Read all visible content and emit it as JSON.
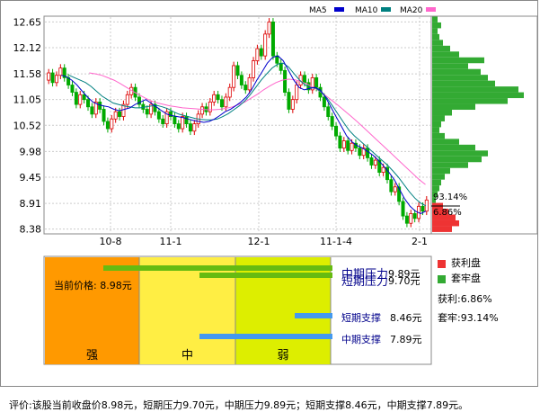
{
  "legend": {
    "ma5": {
      "label": "MA5",
      "color": "#0000cc"
    },
    "ma10": {
      "label": "MA10",
      "color": "#008080"
    },
    "ma20": {
      "label": "MA20",
      "color": "#ff66cc"
    }
  },
  "chips": {
    "profit_pct_label": "93.14%",
    "loss_pct_label": "6.86%"
  },
  "bands": {
    "strong": "强",
    "mid": "中",
    "weak": "弱"
  },
  "current_price_label": "当前价格: 8.98元",
  "levels": [
    {
      "name": "中期压力",
      "value": "9.89元",
      "price": 9.89
    },
    {
      "name": "短期压力",
      "value": "9.70元",
      "price": 9.7
    },
    {
      "name": "短期支撑",
      "value": "8.46元",
      "price": 8.46
    },
    {
      "name": "中期支撑",
      "value": "7.89元",
      "price": 7.89
    }
  ],
  "side_legend": {
    "profit": "获利盘",
    "trapped": "套牢盘",
    "profit_ratio": "获利:6.86%",
    "trapped_ratio": "套牢:93.14%",
    "profit_color": "#ee3333",
    "trapped_color": "#33aa33"
  },
  "footer": "评价:该股当前收盘价8.98元，短期压力9.70元，中期压力9.89元；短期支撑8.46元，中期支撑7.89元。",
  "chart_data": {
    "type": "candlestick",
    "yticks": [
      12.65,
      12.12,
      11.58,
      11.05,
      10.52,
      9.98,
      9.45,
      8.91,
      8.38
    ],
    "ylim": [
      8.3,
      12.75
    ],
    "xticks": [
      "10-8",
      "11-1",
      "12-1",
      "11-1-4",
      "2-1"
    ],
    "grid": true,
    "candles": [
      [
        11.45,
        11.6
      ],
      [
        11.6,
        11.4
      ],
      [
        11.4,
        11.55
      ],
      [
        11.55,
        11.7
      ],
      [
        11.7,
        11.5
      ],
      [
        11.5,
        11.35
      ],
      [
        11.35,
        11.2
      ],
      [
        11.2,
        10.95
      ],
      [
        10.95,
        11.15
      ],
      [
        11.15,
        11.05
      ],
      [
        11.05,
        10.9
      ],
      [
        10.9,
        10.75
      ],
      [
        10.75,
        11.0
      ],
      [
        11.0,
        10.85
      ],
      [
        10.85,
        10.6
      ],
      [
        10.6,
        10.45
      ],
      [
        10.45,
        10.65
      ],
      [
        10.65,
        10.8
      ],
      [
        10.8,
        10.7
      ],
      [
        10.7,
        10.95
      ],
      [
        10.95,
        11.15
      ],
      [
        11.15,
        11.3
      ],
      [
        11.3,
        11.1
      ],
      [
        11.1,
        10.95
      ],
      [
        10.95,
        10.85
      ],
      [
        10.85,
        10.75
      ],
      [
        10.75,
        10.95
      ],
      [
        10.95,
        10.8
      ],
      [
        10.8,
        10.65
      ],
      [
        10.65,
        10.55
      ],
      [
        10.55,
        10.8
      ],
      [
        10.8,
        10.7
      ],
      [
        10.7,
        10.55
      ],
      [
        10.55,
        10.45
      ],
      [
        10.45,
        10.7
      ],
      [
        10.7,
        10.55
      ],
      [
        10.55,
        10.4
      ],
      [
        10.4,
        10.55
      ],
      [
        10.55,
        10.75
      ],
      [
        10.75,
        10.9
      ],
      [
        10.9,
        10.8
      ],
      [
        10.8,
        11.0
      ],
      [
        11.0,
        11.15
      ],
      [
        11.15,
        11.05
      ],
      [
        11.05,
        10.9
      ],
      [
        10.9,
        11.1
      ],
      [
        11.1,
        11.3
      ],
      [
        11.3,
        11.75
      ],
      [
        11.75,
        11.55
      ],
      [
        11.55,
        11.35
      ],
      [
        11.35,
        11.25
      ],
      [
        11.25,
        11.5
      ],
      [
        11.5,
        11.85
      ],
      [
        11.85,
        12.1
      ],
      [
        12.1,
        11.95
      ],
      [
        11.95,
        12.4
      ],
      [
        12.4,
        12.65
      ],
      [
        12.65,
        11.95
      ],
      [
        11.95,
        11.8
      ],
      [
        11.8,
        11.65
      ],
      [
        11.65,
        11.2
      ],
      [
        11.2,
        10.85
      ],
      [
        10.85,
        11.05
      ],
      [
        11.05,
        11.35
      ],
      [
        11.35,
        11.55
      ],
      [
        11.55,
        11.4
      ],
      [
        11.4,
        11.25
      ],
      [
        11.25,
        11.5
      ],
      [
        11.5,
        11.3
      ],
      [
        11.3,
        11.1
      ],
      [
        11.1,
        10.9
      ],
      [
        10.9,
        10.7
      ],
      [
        10.7,
        10.5
      ],
      [
        10.5,
        10.3
      ],
      [
        10.3,
        10.05
      ],
      [
        10.05,
        10.2
      ],
      [
        10.2,
        10.0
      ],
      [
        10.0,
        10.15
      ],
      [
        10.15,
        10.05
      ],
      [
        10.05,
        9.9
      ],
      [
        9.9,
        10.05
      ],
      [
        10.05,
        9.85
      ],
      [
        9.85,
        9.7
      ],
      [
        9.7,
        9.8
      ],
      [
        9.8,
        9.55
      ],
      [
        9.55,
        9.65
      ],
      [
        9.65,
        9.4
      ],
      [
        9.4,
        9.15
      ],
      [
        9.15,
        9.25
      ],
      [
        9.25,
        8.95
      ],
      [
        8.95,
        8.65
      ],
      [
        8.65,
        8.5
      ],
      [
        8.5,
        8.7
      ],
      [
        8.7,
        8.6
      ],
      [
        8.6,
        8.85
      ],
      [
        8.85,
        8.75
      ],
      [
        8.75,
        8.98
      ]
    ],
    "ma5": [
      11.55,
      11.52,
      11.45,
      11.35,
      11.22,
      11.1,
      11.0,
      10.95,
      10.92,
      10.9,
      10.85,
      10.82,
      10.85,
      10.88,
      10.95,
      11.0,
      11.05,
      10.98,
      10.9,
      10.82,
      10.75,
      10.72,
      10.7,
      10.68,
      10.65,
      10.62,
      10.6,
      10.58,
      10.6,
      10.65,
      10.72,
      10.8,
      10.85,
      10.92,
      11.0,
      11.1,
      11.25,
      11.45,
      11.62,
      11.8,
      11.92,
      11.95,
      11.85,
      11.65,
      11.45,
      11.3,
      11.25,
      11.28,
      11.3,
      11.25,
      11.1,
      10.9,
      10.7,
      10.5,
      10.3,
      10.18,
      10.1,
      10.05,
      9.98,
      9.9,
      9.8,
      9.68,
      9.55,
      9.4,
      9.2,
      9.0,
      8.85,
      8.75,
      8.7,
      8.75
    ],
    "ma10": [
      11.55,
      11.5,
      11.45,
      11.4,
      11.32,
      11.22,
      11.12,
      11.05,
      10.98,
      10.95,
      10.92,
      10.9,
      10.88,
      10.88,
      10.9,
      10.92,
      10.93,
      10.9,
      10.86,
      10.8,
      10.75,
      10.72,
      10.69,
      10.66,
      10.64,
      10.63,
      10.63,
      10.65,
      10.7,
      10.76,
      10.84,
      10.92,
      11.02,
      11.15,
      11.3,
      11.45,
      11.58,
      11.7,
      11.78,
      11.8,
      11.72,
      11.58,
      11.45,
      11.35,
      11.3,
      11.28,
      11.2,
      11.08,
      10.92,
      10.75,
      10.58,
      10.42,
      10.3,
      10.2,
      10.1,
      10.0,
      9.9,
      9.8,
      9.7,
      9.58,
      9.45,
      9.3,
      9.15,
      9.02,
      8.92,
      8.86
    ],
    "ma20": [
      11.6,
      11.58,
      11.55,
      11.5,
      11.45,
      11.38,
      11.3,
      11.22,
      11.15,
      11.08,
      11.02,
      10.98,
      10.95,
      10.92,
      10.9,
      10.88,
      10.87,
      10.86,
      10.85,
      10.84,
      10.84,
      10.85,
      10.87,
      10.9,
      10.95,
      11.0,
      11.08,
      11.16,
      11.25,
      11.33,
      11.4,
      11.45,
      11.47,
      11.46,
      11.42,
      11.37,
      11.3,
      11.22,
      11.13,
      11.03,
      10.93,
      10.82,
      10.71,
      10.6,
      10.48,
      10.36,
      10.24,
      10.12,
      10.0,
      9.88,
      9.76,
      9.64,
      9.52,
      9.4,
      9.3
    ],
    "volume_profile": {
      "profit": [
        [
          8.38,
          22
        ],
        [
          8.5,
          30
        ],
        [
          8.62,
          26
        ],
        [
          8.74,
          18
        ],
        [
          8.86,
          12
        ]
      ],
      "trapped": [
        [
          8.98,
          4
        ],
        [
          9.1,
          6
        ],
        [
          9.22,
          8
        ],
        [
          9.34,
          10
        ],
        [
          9.46,
          14
        ],
        [
          9.58,
          20
        ],
        [
          9.7,
          40
        ],
        [
          9.82,
          55
        ],
        [
          9.94,
          62
        ],
        [
          10.06,
          48
        ],
        [
          10.18,
          30
        ],
        [
          10.3,
          14
        ],
        [
          10.42,
          8
        ],
        [
          10.54,
          10
        ],
        [
          10.66,
          14
        ],
        [
          10.78,
          22
        ],
        [
          10.9,
          48
        ],
        [
          11.02,
          84
        ],
        [
          11.14,
          102
        ],
        [
          11.26,
          96
        ],
        [
          11.38,
          70
        ],
        [
          11.5,
          62
        ],
        [
          11.62,
          54
        ],
        [
          11.74,
          40
        ],
        [
          11.86,
          58
        ],
        [
          11.98,
          30
        ],
        [
          12.1,
          20
        ],
        [
          12.22,
          12
        ],
        [
          12.34,
          8
        ],
        [
          12.46,
          6
        ],
        [
          12.58,
          10
        ],
        [
          12.7,
          6
        ]
      ]
    }
  }
}
